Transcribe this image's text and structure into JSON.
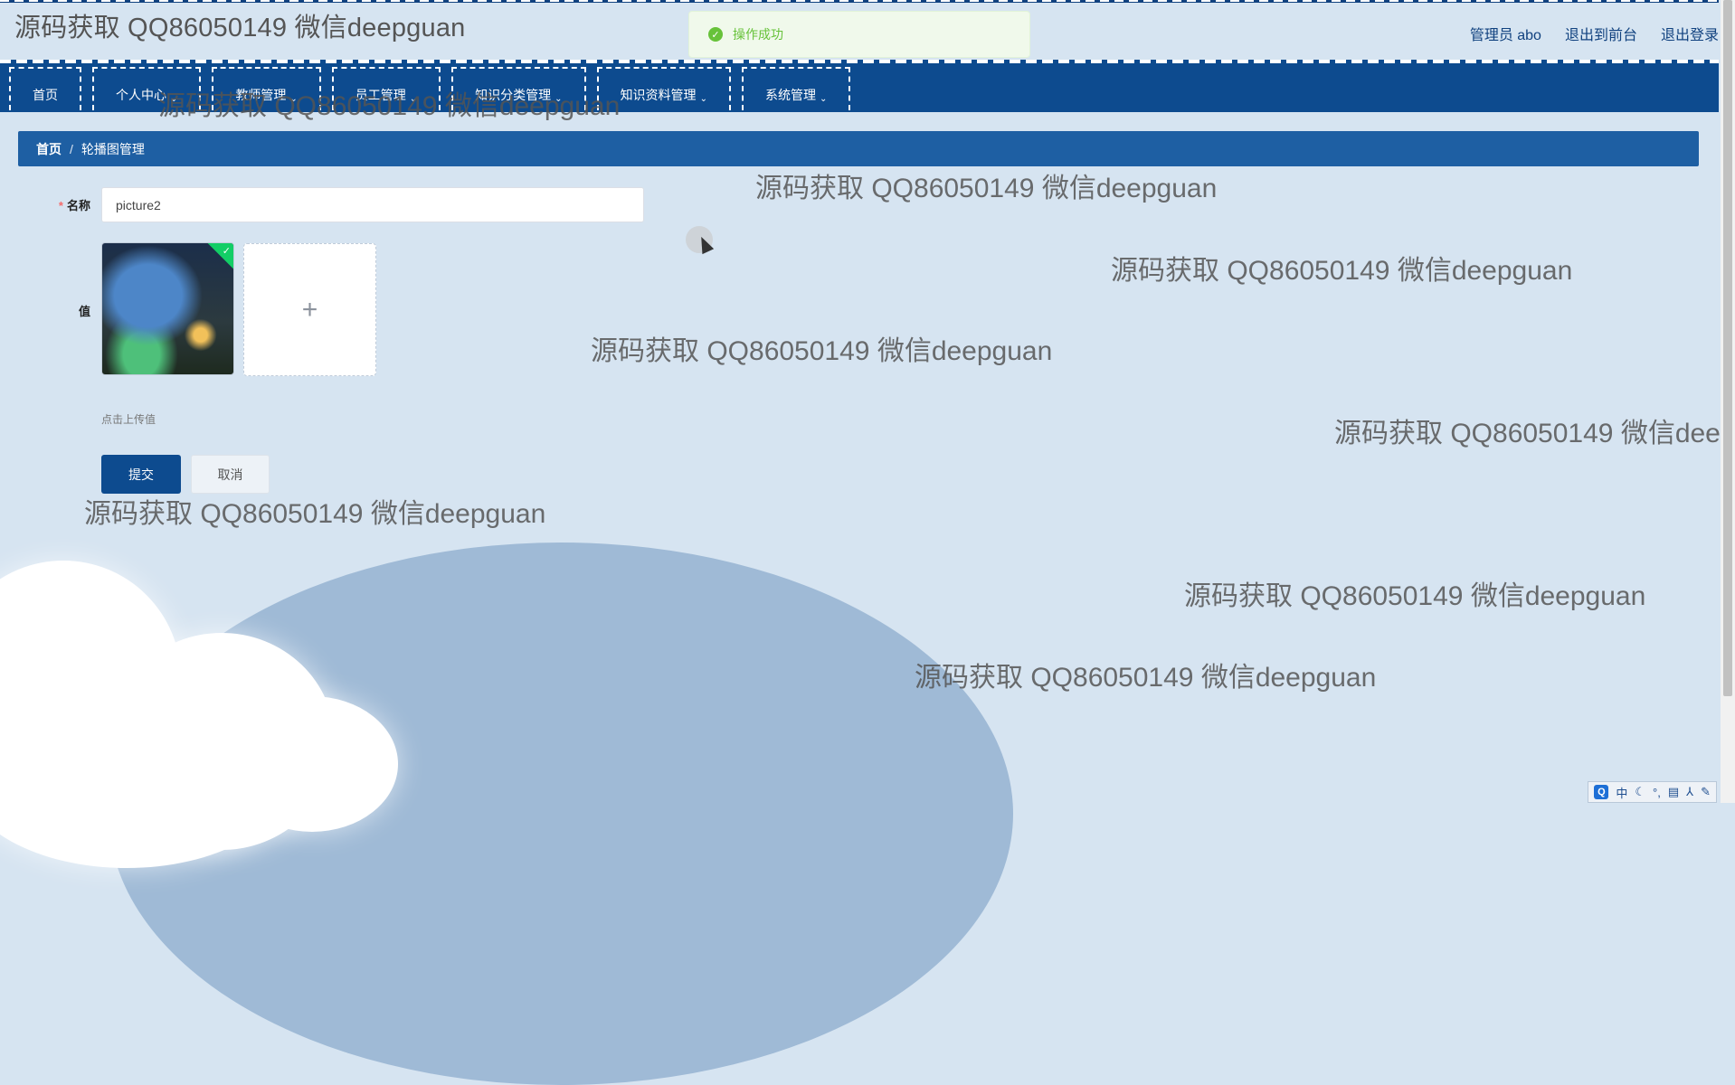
{
  "header": {
    "site_title": "源码获取 QQ86050149 微信deepguan",
    "user_label": "管理员 abo",
    "goto_frontend": "退出到前台",
    "logout": "退出登录"
  },
  "toast": {
    "message": "操作成功",
    "icon": "success-check-icon"
  },
  "nav": {
    "items": [
      {
        "label": "首页"
      },
      {
        "label": "个人中心"
      },
      {
        "label": "教师管理"
      },
      {
        "label": "员工管理"
      },
      {
        "label": "知识分类管理"
      },
      {
        "label": "知识资料管理"
      },
      {
        "label": "系统管理"
      }
    ]
  },
  "breadcrumb": {
    "home": "首页",
    "separator": "/",
    "current": "轮播图管理"
  },
  "form": {
    "name_label": "名称",
    "name_value": "picture2",
    "value_label": "值",
    "upload_hint": "点击上传值",
    "submit": "提交",
    "cancel": "取消"
  },
  "watermark_text": "源码获取 QQ86050149 微信deepguan",
  "watermark_partial": "源码获取 QQ86050149 微信dee",
  "ime": {
    "logo": "Q",
    "lang": "中",
    "items": [
      "☾",
      "°,",
      "▤",
      "⅄",
      "✎"
    ]
  },
  "colors": {
    "nav_bg": "#0d4b8f",
    "breadcrumb_bg": "#1e5fa3",
    "page_bg": "#d6e4f1",
    "success": "#67c23a"
  }
}
